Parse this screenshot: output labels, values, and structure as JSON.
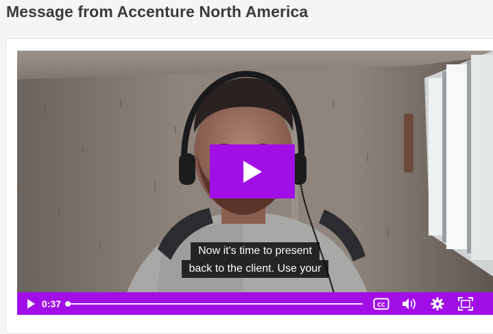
{
  "page": {
    "title": "Message from Accenture North America"
  },
  "player": {
    "captions": [
      "Now it's time to present",
      "back to the client. Use your"
    ],
    "current_time": "0:37",
    "progress_fraction": 0.0,
    "accent_color": "#a10ee6",
    "icons": {
      "overlay": "play-icon",
      "play": "play-icon",
      "captions": "closed-captions-icon",
      "volume": "volume-icon",
      "settings": "settings-icon",
      "fullscreen": "fullscreen-icon"
    }
  }
}
